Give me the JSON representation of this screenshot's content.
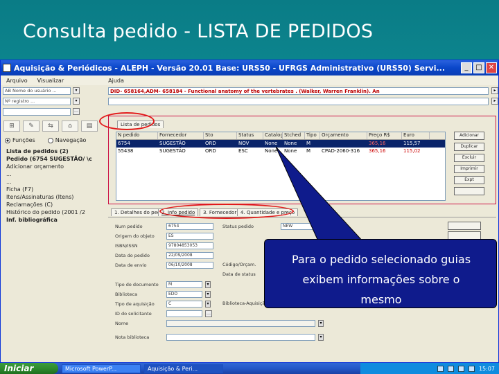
{
  "slide": {
    "title": "Consulta pedido - LISTA DE PEDIDOS"
  },
  "window": {
    "title": "Aquisição & Periódicos - ALEPH - Versão 20.01  Base:  URS50 - UFRGS Administrativo (URS50)  Servi..."
  },
  "menubar": {
    "items": [
      "Arquivo",
      "Visualizar",
      "Ajuda"
    ]
  },
  "record_bar": {
    "did_text": "DID- 658164,ADM- 658184 - Functional anatomy of the vertebrates . (Walker, Warren Franklin). An"
  },
  "left_panel": {
    "radio_functions": "Funções",
    "radio_navigation": "Navegação",
    "tree": [
      "Lista de pedidos (2)",
      "Pedido (6754    SUGESTÃO/ \\c",
      "   Adicionar orçamento",
      "   ...",
      "   ...",
      "   Ficha (F7)",
      "   Itens/Assinaturas (Itens)",
      "   Reclamações (C)",
      "   Histórico do pedido (2001 /2",
      "Inf. bibliográfica"
    ]
  },
  "list_panel": {
    "tab_label": "Lista de pedidos",
    "columns": [
      "N pedido",
      "Fornecedor",
      "Sto",
      "Status",
      "Catalog",
      "Stched",
      "Tipo",
      "Orçamento",
      "Preço R$",
      "Euro"
    ],
    "rows": [
      [
        "6754",
        "SUGESTÃO",
        "ORD",
        "NOV",
        "None",
        "None",
        "M",
        "",
        "365,16",
        "115,57"
      ],
      [
        "55438",
        "SUGESTÃO",
        "ORD",
        "ESC",
        "None",
        "None",
        "M",
        "CPAD-2060-316",
        "365,16",
        "115,02"
      ]
    ],
    "side_buttons": [
      "Adicionar",
      "Duplicar",
      "Excluir",
      "Imprimir",
      "Expt",
      "",
      ""
    ]
  },
  "detail_tabs": [
    "1. Detalhes do pedido",
    "2. Info pedido",
    "3. Fornecedor",
    "4. Quantidade e preço"
  ],
  "form": {
    "fields": [
      {
        "label": "Num pedido",
        "value": "6754"
      },
      {
        "label": "Origem do objeto",
        "value": "ES"
      },
      {
        "label": "ISBN/ISSN",
        "value": "97804853053"
      },
      {
        "label": "Data do pedido",
        "value": "22/09/2008"
      },
      {
        "label": "Data de envio",
        "value": "06/10/2008"
      },
      {
        "label": "Tipo de documento",
        "value": "M"
      },
      {
        "label": "Biblioteca",
        "value": "EDO"
      },
      {
        "label": "Tipo de aquisição",
        "value": "C"
      },
      {
        "label": "ID do solicitante",
        "value": ""
      },
      {
        "label": "Nome",
        "value": ""
      },
      {
        "label": "Nota biblioteca",
        "value": ""
      }
    ],
    "status_label": "Status pedido",
    "status_value": "NEW",
    "code_label": "Código/Orçam.",
    "date_label": "Data de status",
    "bib_label": "Biblioteca-Aquisição"
  },
  "callout": {
    "line1": "Para o pedido selecionado guias",
    "line2": "exibem informações sobre o",
    "line3": "mesmo"
  },
  "taskbar": {
    "start": "Iniciar",
    "item1": "Microsoft PowerP...",
    "item2": "Aquisição & Peri...",
    "clock": "15:07"
  },
  "colors": {
    "slide_bg": "#0e8f96",
    "callout_bg": "#0f1b8c",
    "highlight_oval": "#e21b1b",
    "selected_row": "#0a246a"
  }
}
